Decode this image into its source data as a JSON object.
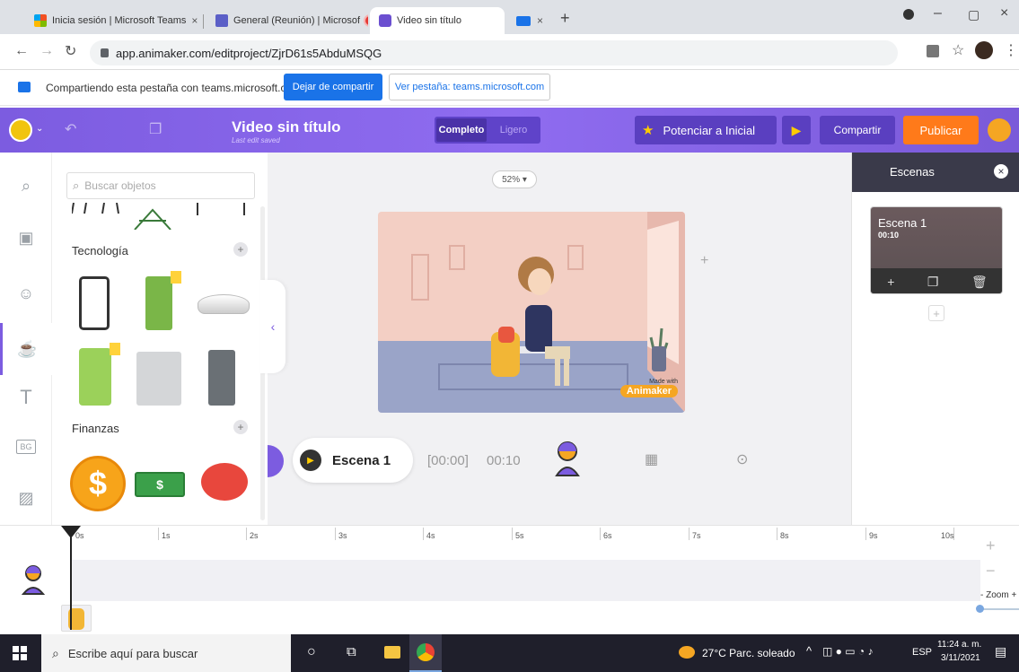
{
  "browser": {
    "tabs": [
      {
        "label": "Inicia sesión | Microsoft Teams",
        "close": "×"
      },
      {
        "label": "General (Reunión) | Microsof",
        "close": "×"
      },
      {
        "label": "Video sin título",
        "close": ""
      },
      {
        "label": "",
        "close": "×"
      }
    ],
    "new_tab": "+",
    "url": "app.animaker.com/editproject/ZjrD61s5AbduMSQG",
    "window_controls": [
      "–",
      "▢",
      "×"
    ]
  },
  "share_bar": {
    "message": "Compartiendo esta pestaña con teams.microsoft.com",
    "stop_button": "Dejar de compartir",
    "view_button": "Ver pestaña: teams.microsoft.com"
  },
  "header": {
    "title": "Video sin título",
    "subtitle": "Last edit saved",
    "mode_full": "Completo",
    "mode_light": "Ligero",
    "upgrade_button": "Potenciar a Inicial",
    "share_button": "Compartir",
    "publish_button": "Publicar"
  },
  "objects_panel": {
    "search_placeholder": "Buscar objetos",
    "sections": [
      {
        "title": "Tecnología",
        "add": "+"
      },
      {
        "title": "Finanzas",
        "add": "+"
      }
    ]
  },
  "canvas": {
    "zoom": "52% ▾",
    "plus": "+",
    "watermark_top": "Made with",
    "watermark": "Animaker",
    "scene_label": "Escena 1",
    "time_start": "[00:00]",
    "time_end": "00:10"
  },
  "scenes_panel": {
    "title": "Escenas",
    "close": "×",
    "scene_name": "Escena 1",
    "scene_time": "00:10",
    "add": "+"
  },
  "timeline": {
    "ticks": [
      "0s",
      "1s",
      "2s",
      "3s",
      "4s",
      "5s",
      "6s",
      "7s",
      "8s",
      "9s",
      "10s"
    ],
    "zoom_label": "- Zoom +",
    "plus": "+",
    "minus": "−"
  },
  "taskbar": {
    "search_placeholder": "Escribe aquí para buscar",
    "weather": "27°C  Parc. soleado",
    "lang": "ESP",
    "time": "11:24 a. m.",
    "date": "3/11/2021"
  },
  "colors": {
    "accent_purple": "#7c5ce0",
    "publish_orange": "#ff7a1a",
    "upgrade_dark": "#5a3fc0",
    "chrome_blue": "#1a73e8"
  }
}
